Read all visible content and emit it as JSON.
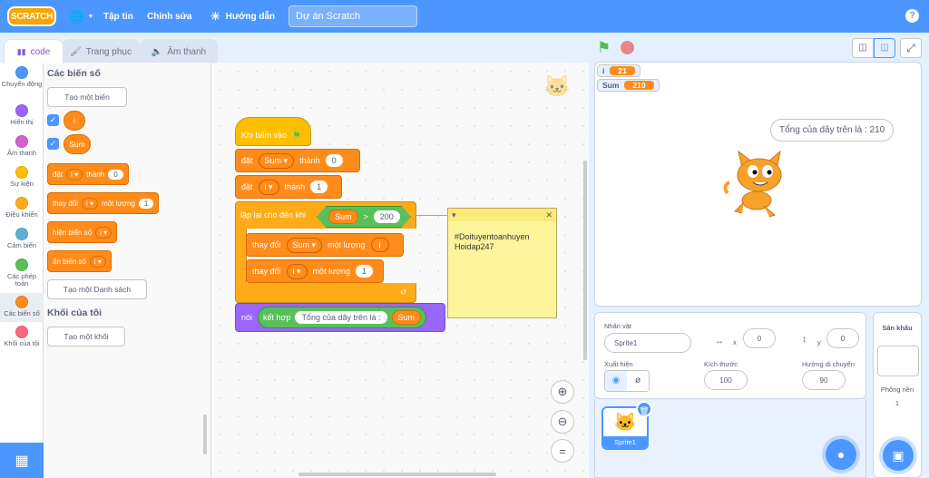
{
  "menubar": {
    "logo": "SCRATCH",
    "file": "Tập tin",
    "edit": "Chỉnh sửa",
    "tutorials": "Hướng dẫn",
    "project_title": "Dự án Scratch",
    "help": "?"
  },
  "tabs": {
    "code": "code",
    "costumes": "Trang phục",
    "sounds": "Âm thanh"
  },
  "categories": [
    {
      "label": "Chuyển động",
      "color": "#4c97ff"
    },
    {
      "label": "Hiển thị",
      "color": "#9966ff"
    },
    {
      "label": "Âm thanh",
      "color": "#cf63cf"
    },
    {
      "label": "Sự kiện",
      "color": "#ffbf00"
    },
    {
      "label": "Điều khiển",
      "color": "#ffab19"
    },
    {
      "label": "Cảm biến",
      "color": "#5cb1d6"
    },
    {
      "label": "Các phép toán",
      "color": "#59c059"
    },
    {
      "label": "Các biến số",
      "color": "#ff8c1a"
    },
    {
      "label": "Khối của tôi",
      "color": "#ff6680"
    }
  ],
  "palette": {
    "variables_heading": "Các biến số",
    "make_variable": "Tạo một biến",
    "var_i": "i",
    "var_sum": "Sum",
    "set_label": "đặt",
    "set_var": "i",
    "set_to": "thành",
    "set_value": "0",
    "change_label": "thay đổi",
    "change_var": "i",
    "change_by": "một lượng",
    "change_value": "1",
    "show_var": "hiện biến số",
    "show_var_name": "i",
    "hide_var": "ẩn biến số",
    "hide_var_name": "i",
    "make_list": "Tạo một Danh sách",
    "myblocks_heading": "Khối của tôi",
    "make_block": "Tạo một khối"
  },
  "script": {
    "hat": "Khi bấm vào",
    "set1_label": "đặt",
    "set1_var": "Sum",
    "set1_to": "thành",
    "set1_value": "0",
    "set2_label": "đặt",
    "set2_var": "i",
    "set2_to": "thành",
    "set2_value": "1",
    "repeat_label": "lặp lại cho đến khi",
    "cond_left": "Sum",
    "cond_op": ">",
    "cond_right": "200",
    "change1_label": "thay đổi",
    "change1_var": "Sum",
    "change1_by": "một lượng",
    "change1_value": "i",
    "change2_label": "thay đổi",
    "change2_var": "i",
    "change2_by": "một lượng",
    "change2_value": "1",
    "say_label": "nói",
    "join_label": "kết hợp",
    "join_text": "Tổng của dãy trên là :",
    "join_var": "Sum",
    "comment_line1": "#Doituyentoanhuyen",
    "comment_line2": "Hoidap247"
  },
  "stage": {
    "monitor_i_label": "i",
    "monitor_i_value": "21",
    "monitor_sum_label": "Sum",
    "monitor_sum_value": "210",
    "speech": "Tổng của dãy trên là : 210"
  },
  "sprite_info": {
    "sprite_label": "Nhân vật",
    "sprite_name": "Sprite1",
    "x_label": "x",
    "x_value": "0",
    "y_label": "y",
    "y_value": "0",
    "show_label": "Xuất hiện",
    "size_label": "Kích thước",
    "size_value": "100",
    "direction_label": "Hướng di chuyển",
    "direction_value": "90",
    "thumb_name": "Sprite1"
  },
  "stage_panel": {
    "title": "Sân khấu",
    "backdrops_label": "Phông nền",
    "backdrops_count": "1"
  },
  "colors": {
    "accent": "#4c97ff",
    "variables": "#ff8c1a",
    "control": "#ffab19",
    "events": "#ffbf00",
    "operators": "#59c059",
    "looks": "#9966ff"
  }
}
